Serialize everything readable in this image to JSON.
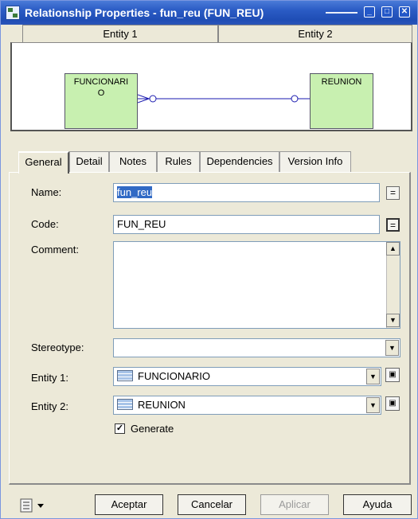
{
  "window": {
    "title": "Relationship Properties - fun_reu (FUN_REU)"
  },
  "diagram": {
    "entity1_header": "Entity 1",
    "entity2_header": "Entity 2",
    "entity1_box": "FUNCIONARIO",
    "entity1_box_line1": "FUNCIONARI",
    "entity1_box_line2": "O",
    "entity2_box": "REUNION",
    "entity_fill_color": "#c8f0b0"
  },
  "tabs": [
    "General",
    "Detail",
    "Notes",
    "Rules",
    "Dependencies",
    "Version Info"
  ],
  "active_tab": "General",
  "form": {
    "name_label": "Name:",
    "name_value": "fun_reu",
    "code_label": "Code:",
    "code_value": "FUN_REU",
    "comment_label": "Comment:",
    "comment_value": "",
    "stereotype_label": "Stereotype:",
    "stereotype_value": "",
    "entity1_label": "Entity 1:",
    "entity1_value": "FUNCIONARIO",
    "entity2_label": "Entity 2:",
    "entity2_value": "REUNION",
    "generate_label": "Generate",
    "generate_checked": true,
    "equals_glyph": "="
  },
  "buttons": {
    "accept": "Aceptar",
    "cancel": "Cancelar",
    "apply": "Aplicar",
    "help": "Ayuda"
  },
  "colors": {
    "titlebar": "#245edb",
    "selection": "#316ac5"
  }
}
